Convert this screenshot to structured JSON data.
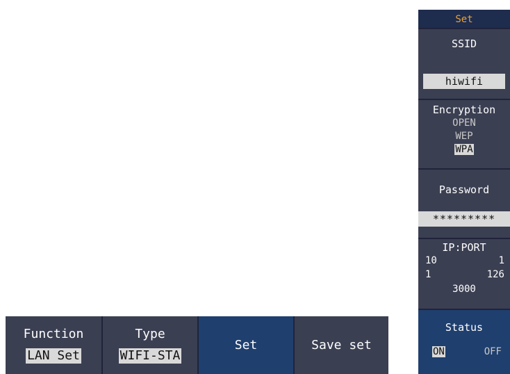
{
  "side_menu": {
    "title": "Set",
    "ssid": {
      "label": "SSID",
      "value": "hiwifi"
    },
    "encryption": {
      "label": "Encryption",
      "options": [
        "OPEN",
        "WEP",
        "WPA"
      ],
      "selected": "WPA"
    },
    "password": {
      "label": "Password",
      "value": "*********"
    },
    "ip_port": {
      "label": "IP:PORT",
      "ip": [
        "10",
        "1",
        "1",
        "126"
      ],
      "port": "3000"
    },
    "status": {
      "label": "Status",
      "on": "ON",
      "off": "OFF",
      "selected": "ON"
    }
  },
  "bottom_menu": {
    "function": {
      "label": "Function",
      "value": "LAN Set"
    },
    "type": {
      "label": "Type",
      "value": "WIFI-STA"
    },
    "set": {
      "label": "Set"
    },
    "save": {
      "label": "Save set"
    }
  },
  "colors": {
    "panel_bg": "#3b3f52",
    "selected_bg": "#1f3f6e",
    "title_text": "#e8a33a",
    "highlight_bg": "#d9d9d9"
  }
}
